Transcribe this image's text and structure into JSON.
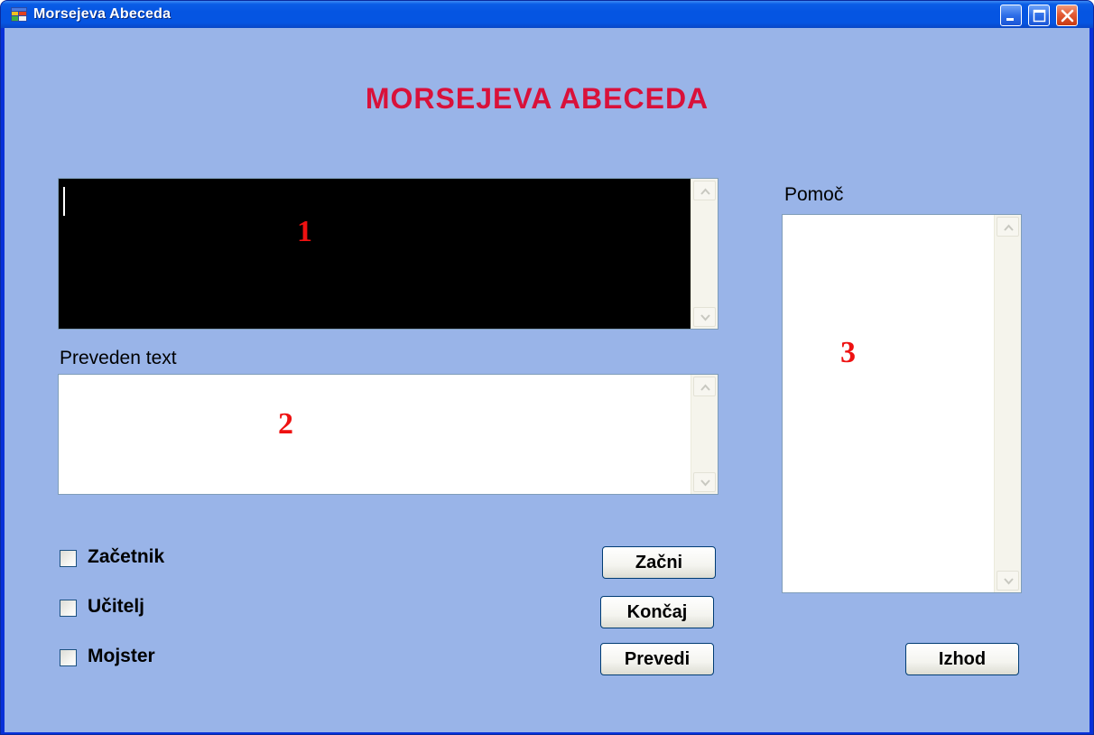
{
  "window": {
    "title": "Morsejeva Abeceda",
    "controls": [
      "minimize",
      "maximize",
      "close"
    ]
  },
  "heading": "MORSEJEVA ABECEDA",
  "input_box": {
    "value": "",
    "marker": "1"
  },
  "translated": {
    "label": "Preveden text",
    "value": "",
    "marker": "2"
  },
  "help": {
    "label": "Pomoč",
    "value": "",
    "marker": "3"
  },
  "levels": [
    {
      "label": "Začetnik",
      "checked": false
    },
    {
      "label": "Učitelj",
      "checked": false
    },
    {
      "label": "Mojster",
      "checked": false
    }
  ],
  "buttons": {
    "start": "Začni",
    "end": "Končaj",
    "translate": "Prevedi",
    "exit": "Izhod"
  },
  "colors": {
    "background": "#99b4e8",
    "heading": "#d9113a",
    "marker": "#ee1111",
    "titlebar": "#0555e2"
  }
}
